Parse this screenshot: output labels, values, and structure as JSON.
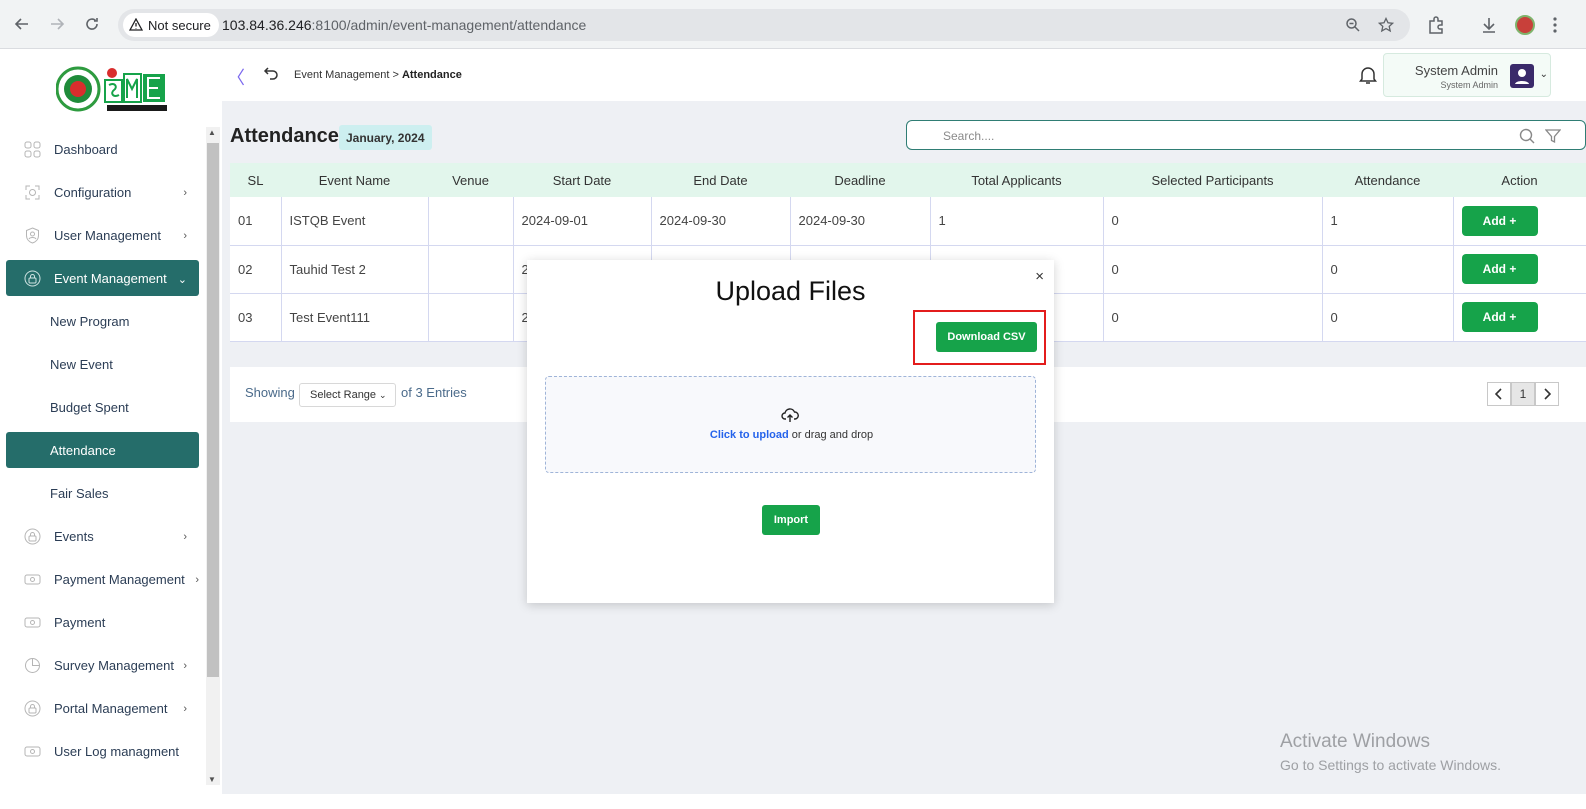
{
  "browser": {
    "security_label": "Not secure",
    "url_host": "103.84.36.246",
    "url_path": ":8100/admin/event-management/attendance"
  },
  "sidebar": {
    "items": [
      {
        "label": "Dashboard",
        "icon": "dashboard-icon",
        "chevron": ""
      },
      {
        "label": "Configuration",
        "icon": "config-icon",
        "chevron": "›"
      },
      {
        "label": "User Management",
        "icon": "user-shield-icon",
        "chevron": "›"
      },
      {
        "label": "Event Management",
        "icon": "lock-icon",
        "chevron": "⌄"
      },
      {
        "label": "New Program"
      },
      {
        "label": "New Event"
      },
      {
        "label": "Budget Spent"
      },
      {
        "label": "Attendance"
      },
      {
        "label": "Fair Sales"
      },
      {
        "label": "Events",
        "icon": "lock-icon",
        "chevron": "›"
      },
      {
        "label": "Payment Management",
        "icon": "money-icon",
        "chevron": "›"
      },
      {
        "label": "Payment",
        "icon": "money-icon",
        "chevron": ""
      },
      {
        "label": "Survey Management",
        "icon": "pie-icon",
        "chevron": "›"
      },
      {
        "label": "Portal Management",
        "icon": "lock-icon",
        "chevron": "›"
      },
      {
        "label": "User Log managment",
        "icon": "money-icon",
        "chevron": ""
      }
    ]
  },
  "header": {
    "breadcrumb_parent": "Event Management",
    "breadcrumb_current": "Attendance",
    "user_name": "System Admin",
    "user_role": "System Admin"
  },
  "page": {
    "title": "Attendance",
    "month_badge": "January, 2024",
    "search_placeholder": "Search...."
  },
  "table": {
    "columns": [
      "SL",
      "Event Name",
      "Venue",
      "Start Date",
      "End Date",
      "Deadline",
      "Total Applicants",
      "Selected Participants",
      "Attendance",
      "Action"
    ],
    "rows": [
      [
        "01",
        "ISTQB Event",
        "",
        "2024-09-01",
        "2024-09-30",
        "2024-09-30",
        "1",
        "0",
        "1",
        "Add +"
      ],
      [
        "02",
        "Tauhid Test 2",
        "",
        "2",
        "",
        "",
        "",
        "0",
        "0",
        "Add +"
      ],
      [
        "03",
        "Test Event111",
        "",
        "2",
        "",
        "",
        "",
        "0",
        "0",
        "Add +"
      ]
    ]
  },
  "pagination": {
    "showing_label": "Showing",
    "range_label": "Select Range",
    "entries_label": "of 3 Entries",
    "current_page": "1"
  },
  "modal": {
    "title": "Upload Files",
    "close_label": "×",
    "download_label": "Download CSV",
    "upload_link": "Click to upload",
    "upload_hint": " or drag and drop",
    "import_label": "Import"
  },
  "watermark": {
    "line1": "Activate Windows",
    "line2": "Go to Settings to activate Windows."
  }
}
